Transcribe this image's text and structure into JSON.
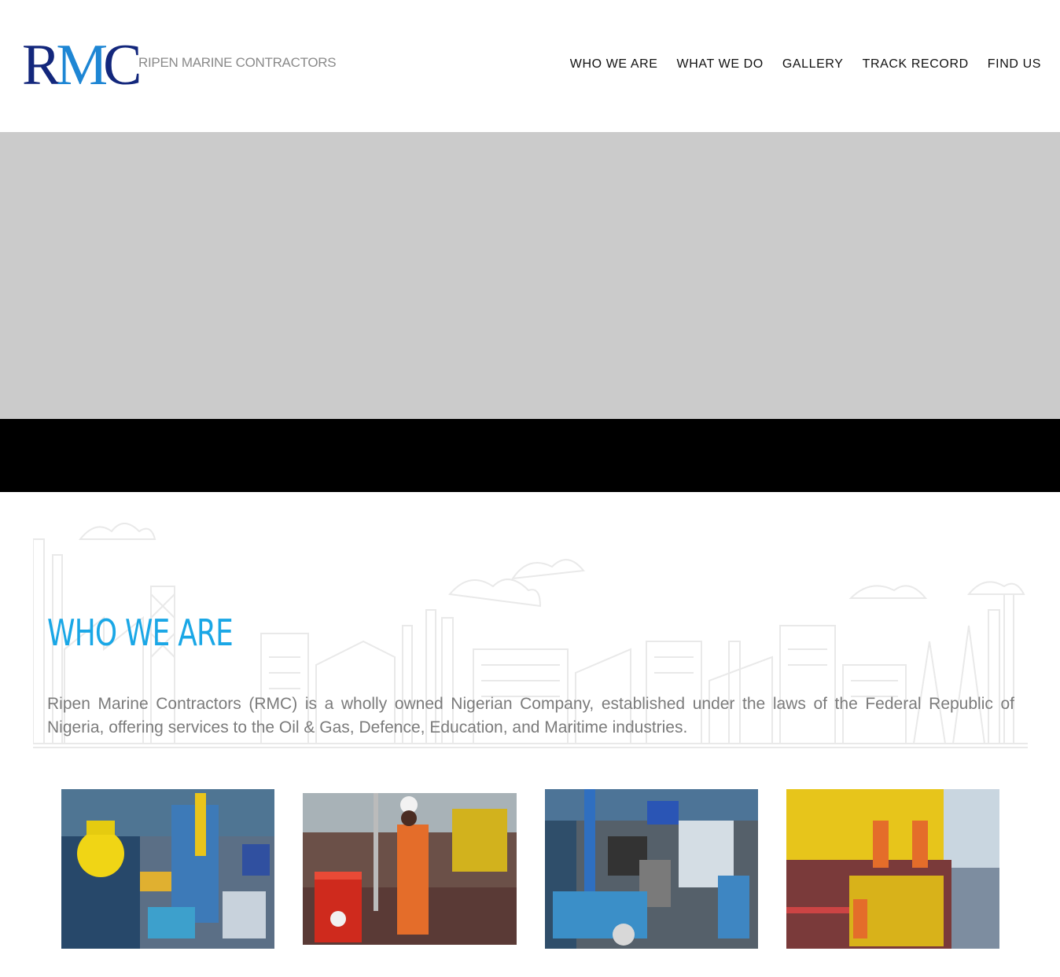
{
  "brand": {
    "logo_letters": "RMC",
    "logo_text": "RIPEN MARINE CONTRACTORS",
    "colors": {
      "navy": "#13277c",
      "blue": "#1e86d4",
      "accent": "#1aa7e6"
    }
  },
  "nav": {
    "items": [
      "WHO WE ARE",
      "WHAT WE DO",
      "GALLERY",
      "TRACK RECORD",
      "FIND US"
    ]
  },
  "about": {
    "title": "WHO WE ARE",
    "text": "Ripen Marine Contractors (RMC) is a wholly owned Nigerian Company, established under the laws of the Federal Republic of Nigeria, offering services to the Oil & Gas, Defence, Education, and Maritime industries."
  },
  "gallery": [
    {
      "icon": "photo-buoy-vessel-deck"
    },
    {
      "icon": "photo-worker-drums"
    },
    {
      "icon": "photo-vessel-deck-winch"
    },
    {
      "icon": "photo-workers-platform"
    }
  ]
}
